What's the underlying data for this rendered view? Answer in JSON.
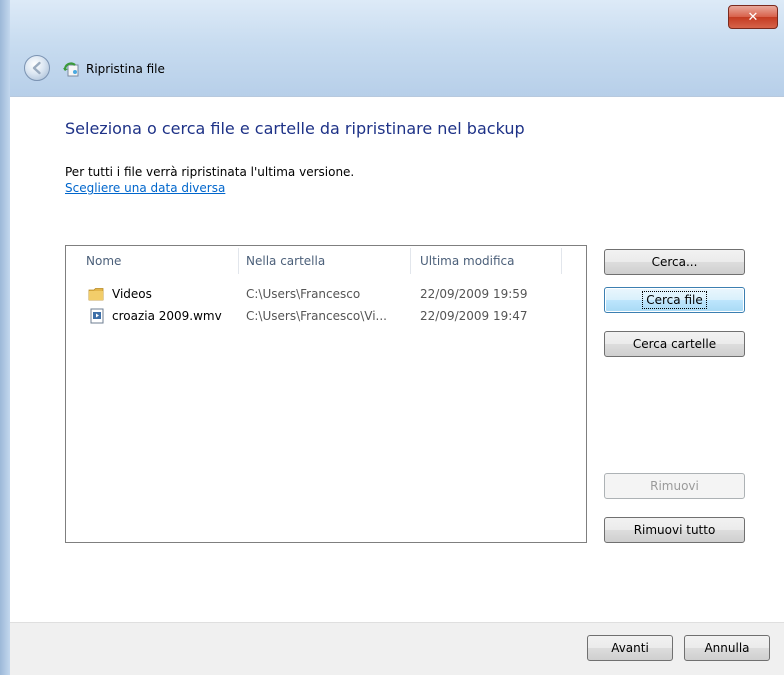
{
  "window": {
    "title": "Ripristina file",
    "close_glyph": "✕",
    "back_icon": "back-arrow-icon",
    "app_icon": "restore-files-icon"
  },
  "main": {
    "heading": "Seleziona o cerca file e cartelle da ripristinare nel backup",
    "info": "Per tutti i file verrà ripristinata l'ultima versione.",
    "link": "Scegliere una data diversa"
  },
  "list": {
    "columns": [
      "Nome",
      "Nella cartella",
      "Ultima modifica"
    ],
    "rows": [
      {
        "icon": "folder-icon",
        "name": "Videos",
        "folder": "C:\\Users\\Francesco",
        "modified": "22/09/2009 19:59"
      },
      {
        "icon": "video-file-icon",
        "name": "croazia 2009.wmv",
        "folder": "C:\\Users\\Francesco\\Vi...",
        "modified": "22/09/2009 19:47"
      }
    ]
  },
  "buttons": {
    "search": "Cerca...",
    "search_files": "Cerca file",
    "search_folders": "Cerca cartelle",
    "remove": "Rimuovi",
    "remove_all": "Rimuovi tutto",
    "next": "Avanti",
    "cancel": "Annulla"
  },
  "colors": {
    "heading": "#1e3287",
    "link": "#0066cc",
    "close_button": "#c43b22"
  }
}
